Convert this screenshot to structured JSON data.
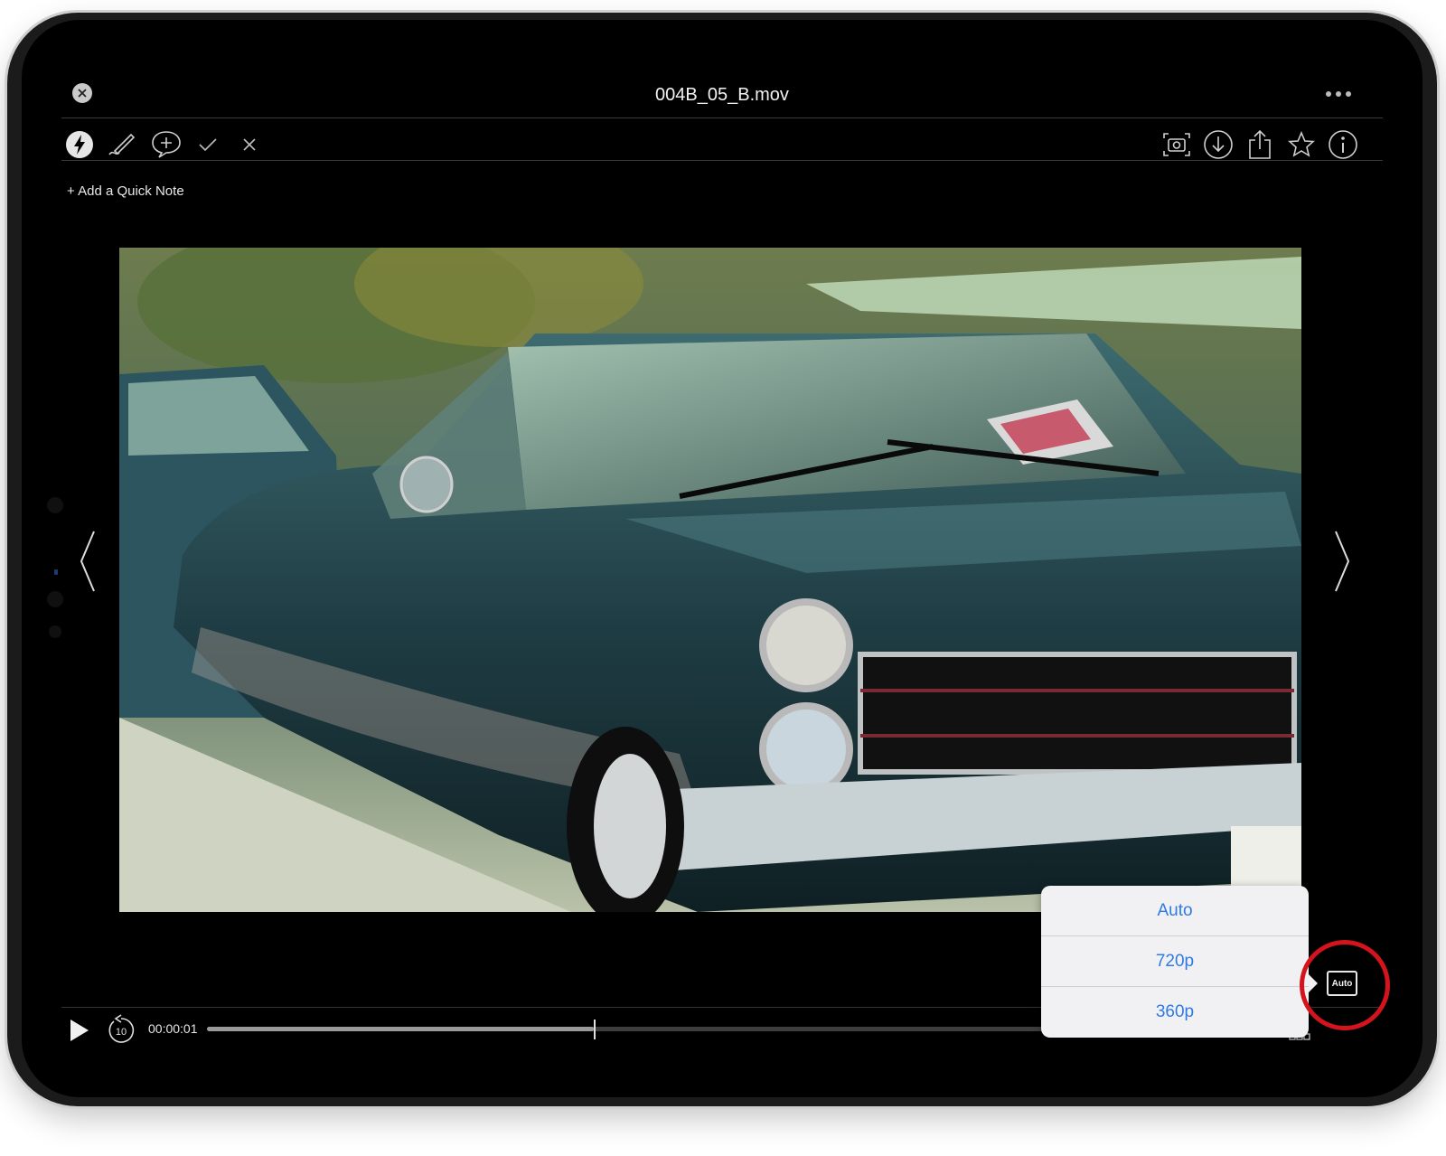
{
  "header": {
    "title": "004B_05_B.mov",
    "close_icon": "close-icon",
    "more_icon": "more-icon"
  },
  "toolbar": {
    "left_icons": [
      "lightning-icon",
      "pen-icon",
      "comment-add-icon",
      "checkmark-icon",
      "x-icon"
    ],
    "right_icons": [
      "screenshot-icon",
      "download-icon",
      "share-icon",
      "star-icon",
      "info-icon"
    ]
  },
  "quick_note": {
    "label": "+ Add a Quick Note"
  },
  "player": {
    "timecode": "00:00:01",
    "progress": 0.46,
    "play_icon": "play-icon",
    "rewind_icon": "rewind-10-icon",
    "rewind_label": "10"
  },
  "quality_menu": {
    "options": [
      "Auto",
      "720p",
      "360p"
    ],
    "selected": "Auto",
    "button_label": "Auto"
  },
  "colors": {
    "accent_blue": "#2f7ae5",
    "highlight_red": "#d3141c"
  }
}
